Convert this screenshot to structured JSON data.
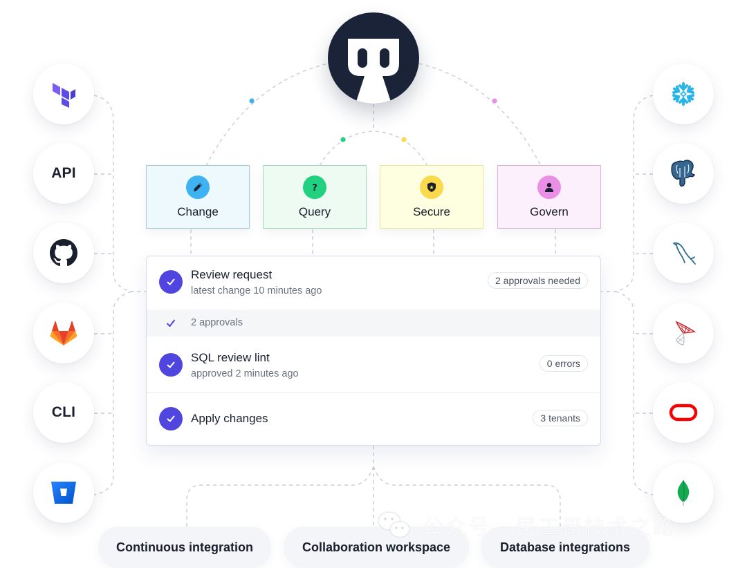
{
  "hub": {
    "icon": "bytebase-logo-icon"
  },
  "left_sources": [
    {
      "name": "terraform",
      "icon": "terraform-icon",
      "label": ""
    },
    {
      "name": "api",
      "icon": "",
      "label": "API"
    },
    {
      "name": "github",
      "icon": "github-icon",
      "label": ""
    },
    {
      "name": "gitlab",
      "icon": "gitlab-icon",
      "label": ""
    },
    {
      "name": "cli",
      "icon": "",
      "label": "CLI"
    },
    {
      "name": "bitbucket",
      "icon": "bitbucket-icon",
      "label": ""
    }
  ],
  "right_databases": [
    {
      "name": "snowflake",
      "icon": "snowflake-icon"
    },
    {
      "name": "postgresql",
      "icon": "postgresql-icon"
    },
    {
      "name": "mysql",
      "icon": "mysql-icon"
    },
    {
      "name": "sqlserver",
      "icon": "sqlserver-icon"
    },
    {
      "name": "oracle",
      "icon": "oracle-icon"
    },
    {
      "name": "mongodb",
      "icon": "mongodb-icon"
    }
  ],
  "features": [
    {
      "label": "Change",
      "icon": "pencil-icon",
      "color": "#3fb2f2",
      "bg": "#eef9fd",
      "border": "#a9c9dc"
    },
    {
      "label": "Query",
      "icon": "question-icon",
      "color": "#22d17f",
      "bg": "#eefbf3",
      "border": "#a9d8c1"
    },
    {
      "label": "Secure",
      "icon": "shield-icon",
      "color": "#fad94e",
      "bg": "#fefee0",
      "border": "#ece99a"
    },
    {
      "label": "Govern",
      "icon": "user-icon",
      "color": "#ea8ee6",
      "bg": "#fdf0fd",
      "border": "#dcb2de"
    }
  ],
  "connector_dots": [
    "#3fb2f2",
    "#22d17f",
    "#fad94e",
    "#ea8ee6"
  ],
  "workflow": {
    "review": {
      "title": "Review request",
      "subtitle": "latest change 10 minutes ago",
      "badge": "2 approvals needed"
    },
    "approvals": {
      "label": "2 approvals"
    },
    "lint": {
      "title": "SQL review lint",
      "subtitle": "approved 2 minutes ago",
      "badge": "0 errors"
    },
    "apply": {
      "title": "Apply changes",
      "badge": "3 tenants"
    },
    "accent": "#5145e0"
  },
  "bottom": [
    {
      "label": "Continuous integration"
    },
    {
      "label": "Collaboration workspace"
    },
    {
      "label": "Database integrations"
    }
  ],
  "watermark": {
    "text": "公众号 · 民工哥技术之路",
    "icon": "wechat-icon"
  }
}
